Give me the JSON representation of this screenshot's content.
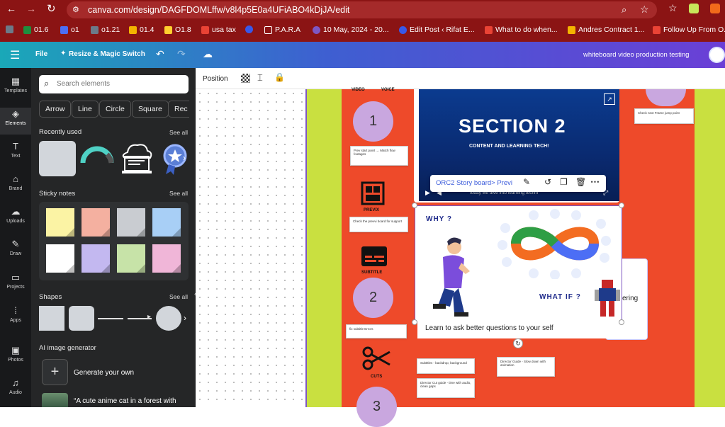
{
  "browser": {
    "url": "canva.com/design/DAGFDOMLffw/v8l4p5E0a4UFiABO4kDjJA/edit",
    "bookmarks": [
      {
        "label": "01.6",
        "icon": "sheets-icon",
        "color": "#1e8e3e"
      },
      {
        "label": "o1",
        "icon": "shield-icon",
        "color": "#4c6ef5"
      },
      {
        "label": "o1.21",
        "icon": "link-icon",
        "color": "#6c7a89"
      },
      {
        "label": "01.4",
        "icon": "drive-icon",
        "color": "#f4b400"
      },
      {
        "label": "O1.8",
        "icon": "miro-icon",
        "color": "#ffd02f"
      },
      {
        "label": "usa tax",
        "icon": "gmail-icon",
        "color": "#ea4335"
      },
      {
        "label": "",
        "icon": "wordpress-icon",
        "color": "#3858e9"
      },
      {
        "label": "P.A.R.A",
        "icon": "folder-icon",
        "color": "#ffffff"
      },
      {
        "label": "10 May, 2024 - 20...",
        "icon": "calendar-icon",
        "color": "#7e57c2"
      },
      {
        "label": "Edit Post ‹ Rifat E...",
        "icon": "wordpress-icon",
        "color": "#3858e9"
      },
      {
        "label": "What to do when...",
        "icon": "gmail-icon",
        "color": "#ea4335"
      },
      {
        "label": "Andres Contract 1...",
        "icon": "drive-icon",
        "color": "#f4b400"
      },
      {
        "label": "Follow Up From O...",
        "icon": "gmail-icon",
        "color": "#ea4335"
      }
    ]
  },
  "canva_header": {
    "file_label": "File",
    "resize_label": "Resize & Magic Switch",
    "doc_title": "whiteboard video production testing"
  },
  "rail": [
    {
      "label": "Templates",
      "icon": "templates-icon",
      "glyph": "▦"
    },
    {
      "label": "Elements",
      "icon": "elements-icon",
      "glyph": "◈"
    },
    {
      "label": "Text",
      "icon": "text-icon",
      "glyph": "T"
    },
    {
      "label": "Brand",
      "icon": "brand-icon",
      "glyph": "⌂"
    },
    {
      "label": "Uploads",
      "icon": "uploads-icon",
      "glyph": "☁"
    },
    {
      "label": "Draw",
      "icon": "draw-icon",
      "glyph": "✎"
    },
    {
      "label": "Projects",
      "icon": "projects-icon",
      "glyph": "▭"
    },
    {
      "label": "Apps",
      "icon": "apps-icon",
      "glyph": "⁞"
    },
    {
      "label": "Photos",
      "icon": "photos-icon",
      "glyph": "▣"
    },
    {
      "label": "Audio",
      "icon": "audio-icon",
      "glyph": "♫"
    }
  ],
  "panel": {
    "search_placeholder": "Search elements",
    "chips": [
      "Arrow",
      "Line",
      "Circle",
      "Square",
      "Rec"
    ],
    "recently_used": "Recently used",
    "see_all": "See all",
    "sticky_notes": "Sticky notes",
    "shapes": "Shapes",
    "ai_generator": "AI image generator",
    "generate_label": "Generate your own",
    "ai_example": "“A cute anime cat in a forest with",
    "sticky_colors": [
      "#fbf3a4",
      "#f4b0a0",
      "#c9ccd1",
      "#a8cff6",
      "#ffffff",
      "#c3b8f0",
      "#c7e3a8",
      "#f0b6d8"
    ]
  },
  "editor": {
    "position_label": "Position",
    "video": {
      "title": "SECTION 2",
      "subtitle": "CONTENT AND LEARNING TECH!",
      "link_label": "ORC2 Story board> Previ",
      "caption": "today we dive into learning techni"
    },
    "slide": {
      "why": "WHY ?",
      "what_if": "WHAT IF ?",
      "learn_text": "Learn to ask better questions to your self",
      "ering_text": "ering"
    },
    "board": {
      "video_label": "VIDEO",
      "voice_label": "VOICE",
      "circle_1": "1",
      "circle_2": "2",
      "circle_3": "3",
      "previx": "PREVIX",
      "subtitle": "SUBTITLE",
      "cuts": "CUTS",
      "notes": {
        "prev_start": "Prev start point → Match flow footages",
        "check_prev": "Check the prevvi board for support",
        "fix_sub": "fix subtitle Errors",
        "check_frame": "Check next Frame jump point",
        "subtitles_bg": "Subtitles - backdrop, background",
        "director_cut": "Director Cut guide - time with audio, clean gaps",
        "director_guide": "Director Guide - Slow down with animation"
      }
    }
  }
}
